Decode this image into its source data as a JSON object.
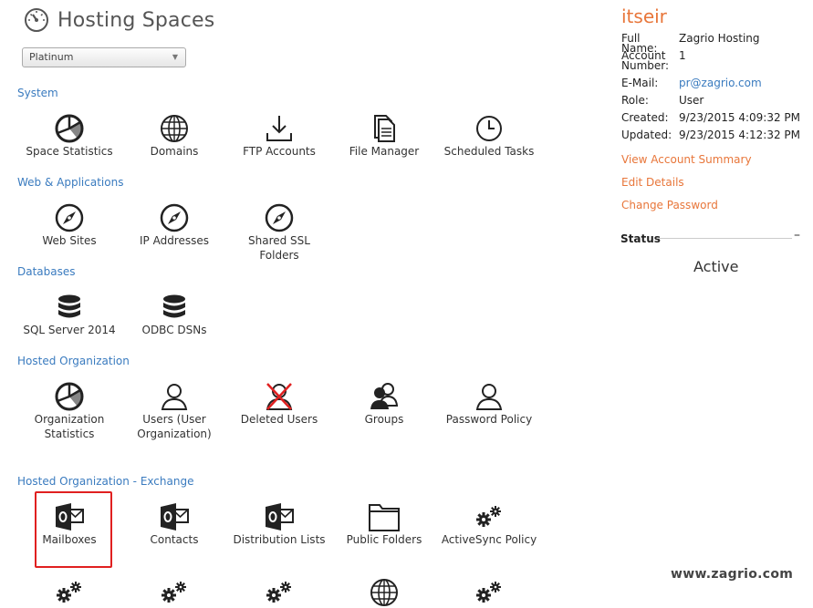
{
  "header": {
    "title": "Hosting Spaces",
    "icon": "gauge-icon"
  },
  "space_selector": {
    "value": "Platinum"
  },
  "sections": {
    "system": {
      "title": "System",
      "items": [
        {
          "label": "Space Statistics",
          "icon": "pie-chart-icon"
        },
        {
          "label": "Domains",
          "icon": "globe-icon"
        },
        {
          "label": "FTP Accounts",
          "icon": "download-icon"
        },
        {
          "label": "File Manager",
          "icon": "documents-icon"
        },
        {
          "label": "Scheduled Tasks",
          "icon": "clock-icon"
        }
      ]
    },
    "web": {
      "title": "Web & Applications",
      "items": [
        {
          "label": "Web Sites",
          "icon": "compass-icon"
        },
        {
          "label": "IP Addresses",
          "icon": "compass-icon"
        },
        {
          "label": "Shared SSL Folders",
          "icon": "compass-icon"
        }
      ]
    },
    "databases": {
      "title": "Databases",
      "items": [
        {
          "label": "SQL Server 2014",
          "icon": "database-icon"
        },
        {
          "label": "ODBC DSNs",
          "icon": "database-icon"
        }
      ]
    },
    "org": {
      "title": "Hosted Organization",
      "items": [
        {
          "label1": "Organization",
          "label2": "Statistics",
          "icon": "pie-chart-icon"
        },
        {
          "label1": "Users (User",
          "label2": "Organization)",
          "icon": "user-icon"
        },
        {
          "label1": "Deleted Users",
          "label2": "",
          "icon": "deleted-user-icon"
        },
        {
          "label1": "Groups",
          "label2": "",
          "icon": "group-icon"
        },
        {
          "label1": "Password Policy",
          "label2": "",
          "icon": "user-icon"
        }
      ]
    },
    "exchange": {
      "title": "Hosted Organization - Exchange",
      "items": [
        {
          "label": "Mailboxes",
          "icon": "outlook-icon"
        },
        {
          "label": "Contacts",
          "icon": "outlook-icon"
        },
        {
          "label": "Distribution Lists",
          "icon": "outlook-icon"
        },
        {
          "label": "Public Folders",
          "icon": "folder-icon"
        },
        {
          "label": "ActiveSync Policy",
          "icon": "gears-icon"
        }
      ]
    }
  },
  "account": {
    "username": "itseir",
    "fields": {
      "full_name_label": "Full Name:",
      "full_name": "Zagrio Hosting",
      "account_number_label": "Account Number:",
      "account_number": "1",
      "email_label": "E-Mail:",
      "email": "pr@zagrio.com",
      "role_label": "Role:",
      "role": "User",
      "created_label": "Created:",
      "created": "9/23/2015 4:09:32 PM",
      "updated_label": "Updated:",
      "updated": "9/23/2015 4:12:32 PM"
    },
    "links": {
      "view_summary": "View Account Summary",
      "edit_details": "Edit Details",
      "change_password": "Change Password"
    },
    "status": {
      "title": "Status",
      "collapse": "–",
      "value": "Active"
    }
  },
  "watermark": "www.zagrio.com",
  "colors": {
    "link": "#3a7bbf",
    "accent": "#e8763a",
    "highlight": "#e02020"
  }
}
